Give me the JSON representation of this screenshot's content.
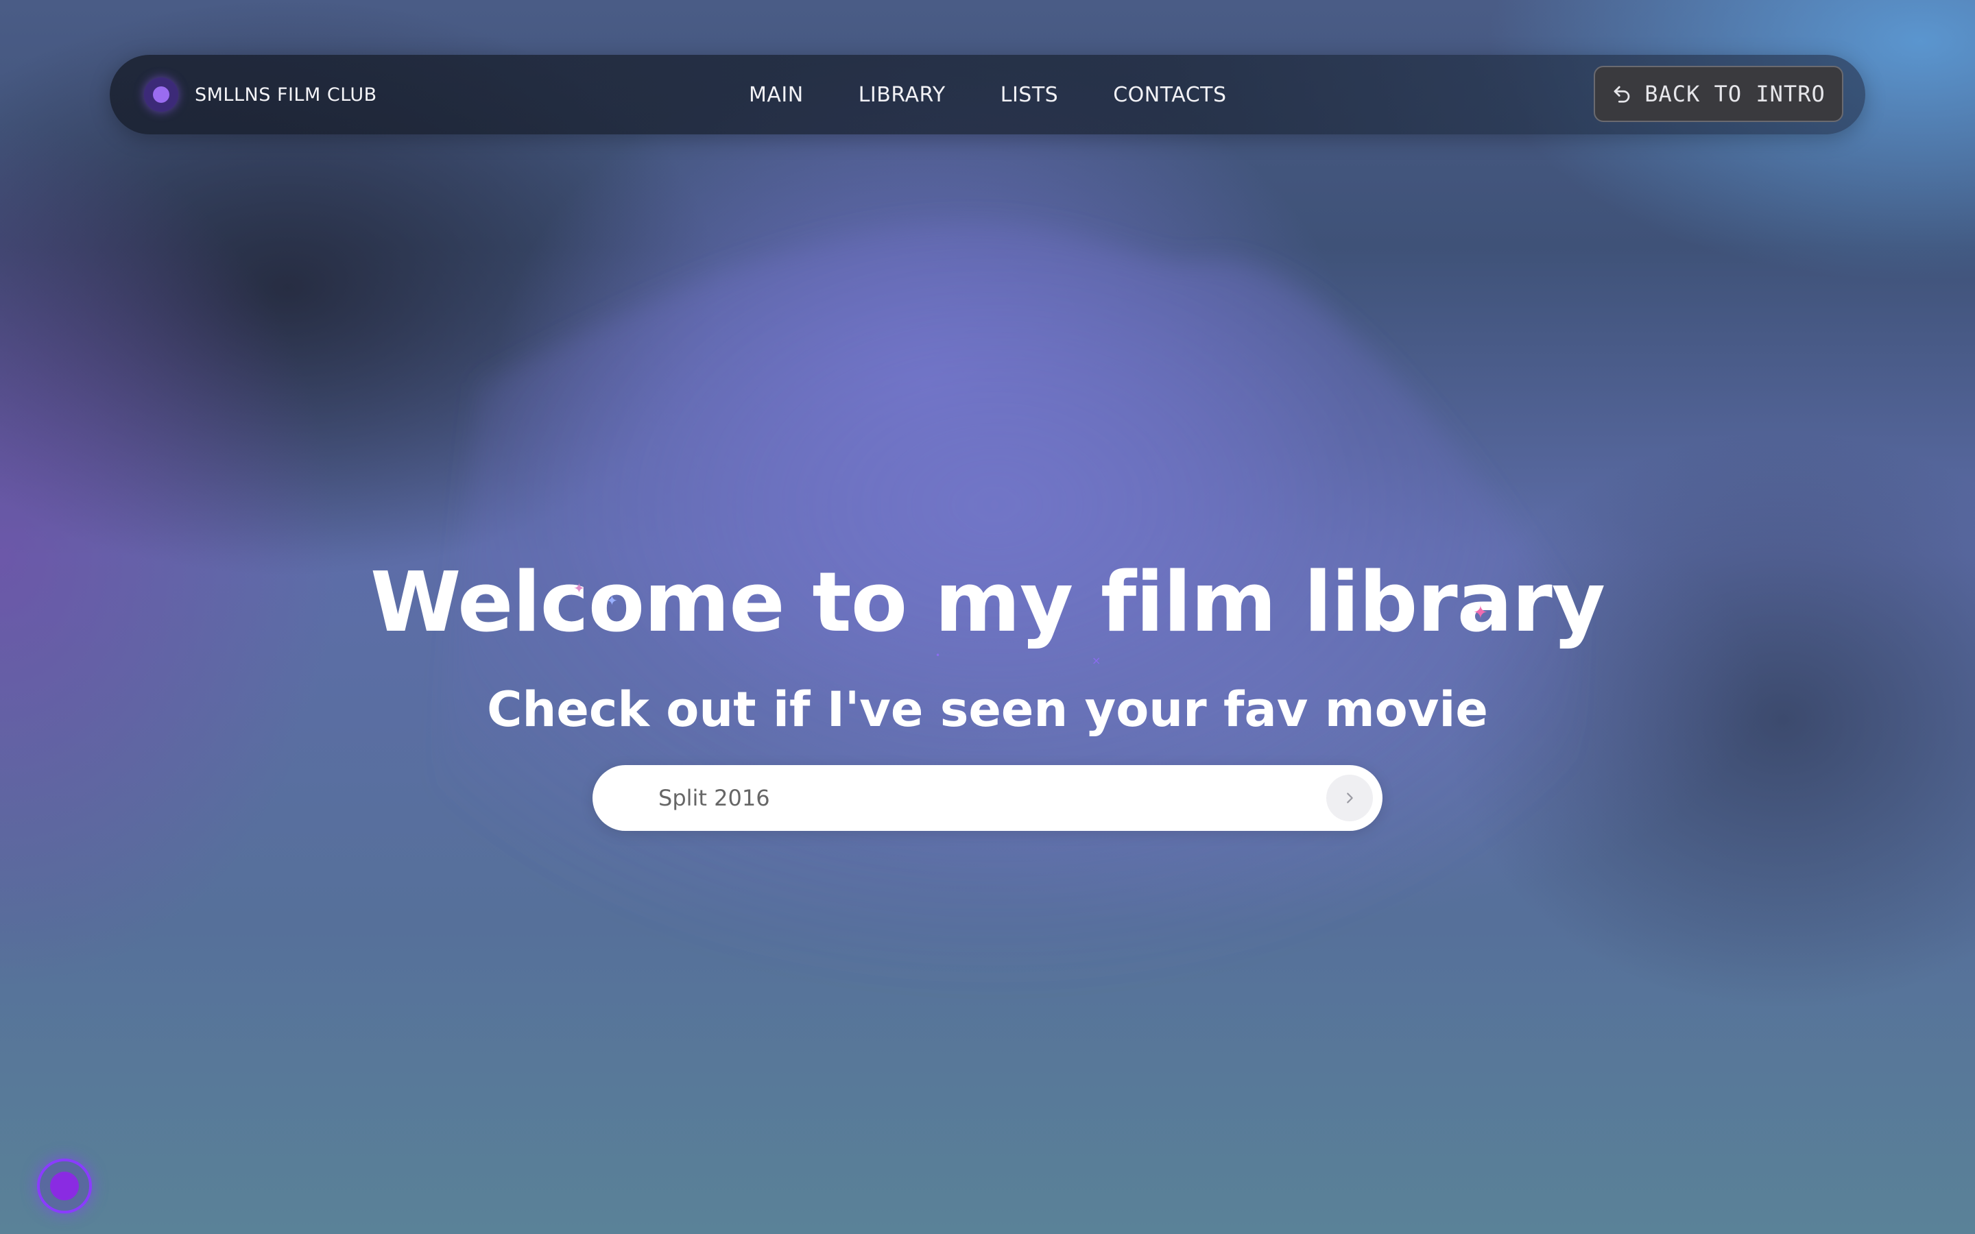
{
  "navbar": {
    "brand": "SMLLNS FILM CLUB",
    "links": [
      {
        "label": "MAIN"
      },
      {
        "label": "LIBRARY"
      },
      {
        "label": "LISTS"
      },
      {
        "label": "CONTACTS"
      }
    ],
    "back_button": {
      "label": "BACK TO INTRO",
      "icon": "undo-arrow-icon"
    }
  },
  "hero": {
    "title": "Welcome to my film library",
    "subtitle": "Check out if I've seen your fav movie"
  },
  "search": {
    "placeholder": "Split 2016",
    "submit_icon": "chevron-right-icon"
  },
  "floating_button": {
    "icon": "record-dot-icon"
  },
  "colors": {
    "accent_purple": "#8a2be2",
    "brand_dot": "#9a6cf0",
    "button_bg": "#3a3a3e"
  }
}
